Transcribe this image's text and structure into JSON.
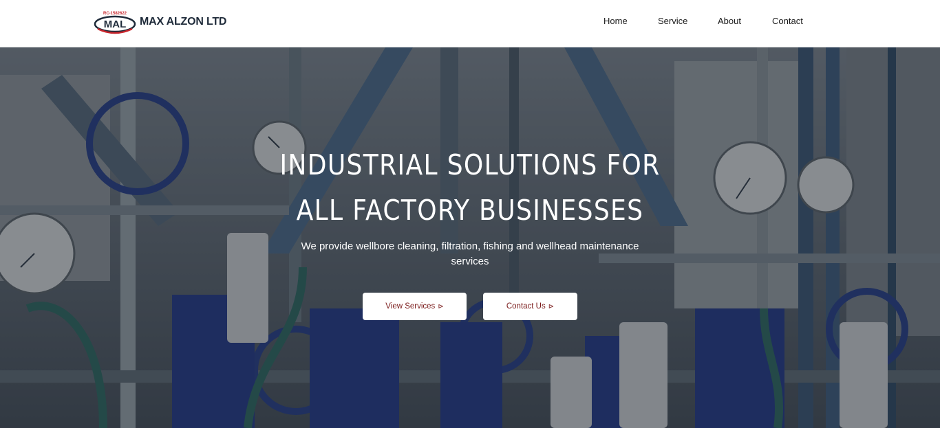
{
  "brand": {
    "name": "MAX ALZON LTD",
    "mark_text": "MAL",
    "rc_number": "RC-1582622",
    "colors": {
      "navy": "#1f2b3a",
      "red": "#c8262d"
    }
  },
  "nav": {
    "items": [
      {
        "label": "Home"
      },
      {
        "label": "Service"
      },
      {
        "label": "About"
      },
      {
        "label": "Contact"
      }
    ]
  },
  "hero": {
    "title_line1": "INDUSTRIAL SOLUTIONS FOR",
    "title_line2": "ALL FACTORY BUSINESSES",
    "subtitle": "We provide wellbore cleaning, filtration, fishing and wellhead maintenance services",
    "buttons": [
      {
        "label": "View Services",
        "icon": "arrow-right-icon"
      },
      {
        "label": "Contact Us",
        "icon": "arrow-right-icon"
      }
    ],
    "background": "industrial pipes and valves photo"
  }
}
